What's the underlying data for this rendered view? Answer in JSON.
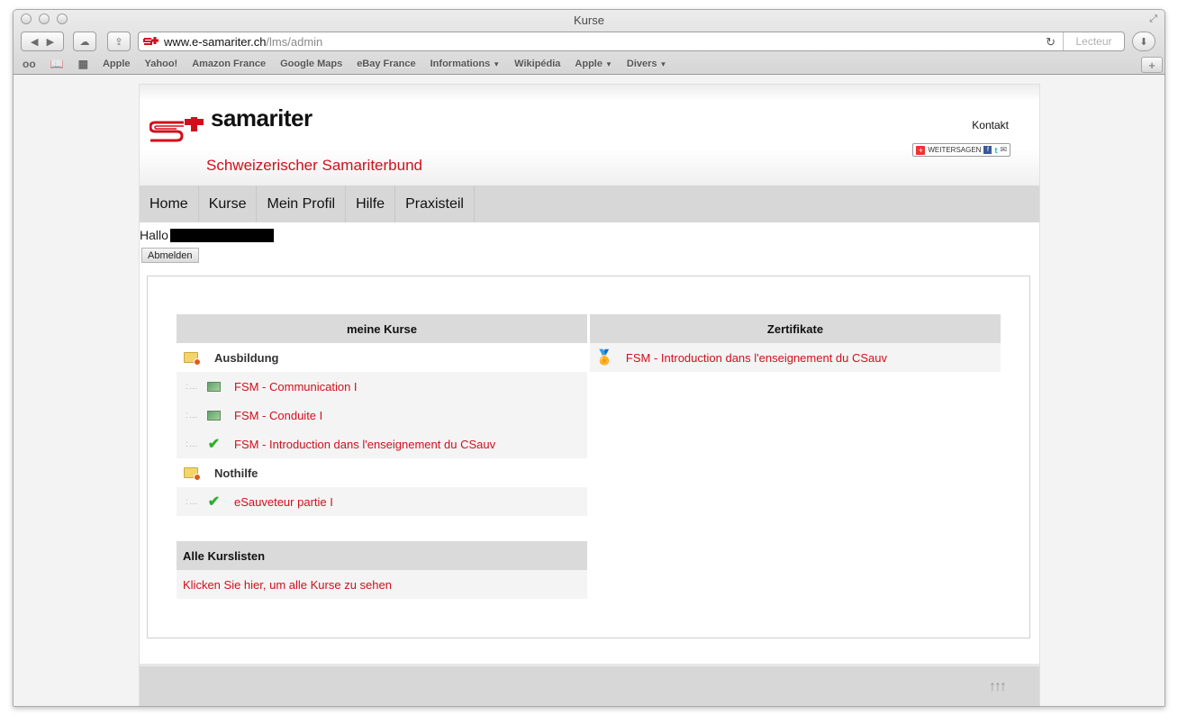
{
  "browser": {
    "window_title": "Kurse",
    "url_host": "www.e-samariter.ch",
    "url_path": "/lms/admin",
    "reader_label": "Lecteur",
    "bookmarks": [
      {
        "label": "Apple",
        "menu": false
      },
      {
        "label": "Yahoo!",
        "menu": false
      },
      {
        "label": "Amazon France",
        "menu": false
      },
      {
        "label": "Google Maps",
        "menu": false
      },
      {
        "label": "eBay France",
        "menu": false
      },
      {
        "label": "Informations",
        "menu": true
      },
      {
        "label": "Wikipédia",
        "menu": false
      },
      {
        "label": "Apple",
        "menu": true
      },
      {
        "label": "Divers",
        "menu": true
      }
    ]
  },
  "header": {
    "logo_text": "samariter",
    "subtitle": "Schweizerischer Samariterbund",
    "contact_link": "Kontakt",
    "share_label": "WEITERSAGEN"
  },
  "nav": {
    "items": [
      "Home",
      "Kurse",
      "Mein Profil",
      "Hilfe",
      "Praxisteil"
    ]
  },
  "user": {
    "greeting": "Hallo",
    "logout_label": "Abmelden"
  },
  "courses": {
    "header": "meine Kurse",
    "groups": [
      {
        "name": "Ausbildung",
        "items": [
          {
            "title": "FSM - Communication I",
            "status": "in-progress"
          },
          {
            "title": "FSM - Conduite I",
            "status": "in-progress"
          },
          {
            "title": "FSM - Introduction dans l'enseignement du CSauv",
            "status": "completed"
          }
        ]
      },
      {
        "name": "Nothilfe",
        "items": [
          {
            "title": "eSauveteur partie I",
            "status": "completed"
          }
        ]
      }
    ]
  },
  "certificates": {
    "header": "Zertifikate",
    "items": [
      "FSM - Introduction dans l'enseignement du CSauv"
    ]
  },
  "all_courses": {
    "header": "Alle Kurslisten",
    "link": "Klicken Sie hier, um alle Kurse zu sehen"
  },
  "footer": {
    "to_top": "↑↑↑"
  },
  "colors": {
    "brand_red": "#d0101d",
    "nav_gray": "#d7d7d7",
    "check_green": "#2cae2c"
  }
}
